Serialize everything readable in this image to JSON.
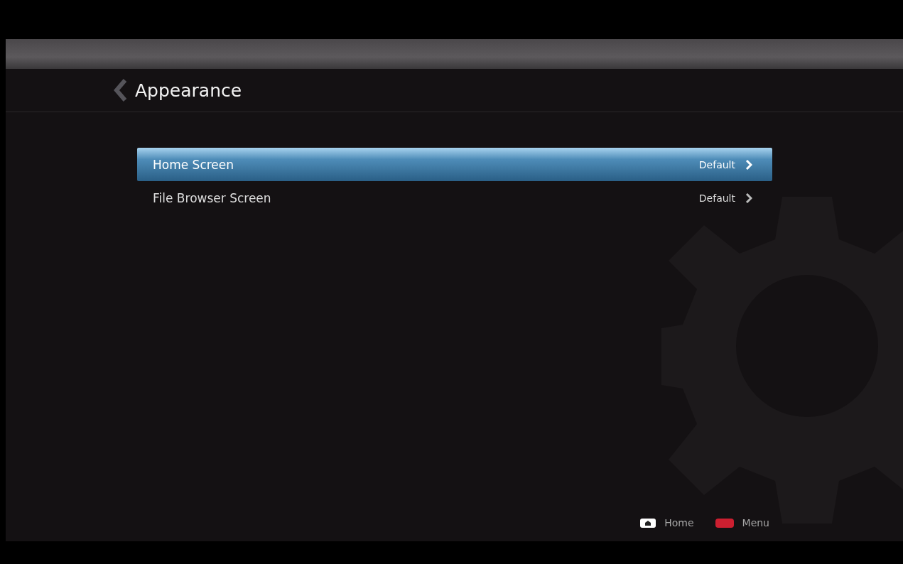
{
  "header": {
    "title": "Appearance"
  },
  "items": [
    {
      "label": "Home Screen",
      "value": "Default",
      "selected": true
    },
    {
      "label": "File Browser Screen",
      "value": "Default",
      "selected": false
    }
  ],
  "hints": [
    {
      "kind": "home",
      "label": "Home"
    },
    {
      "kind": "red",
      "label": "Menu"
    }
  ]
}
